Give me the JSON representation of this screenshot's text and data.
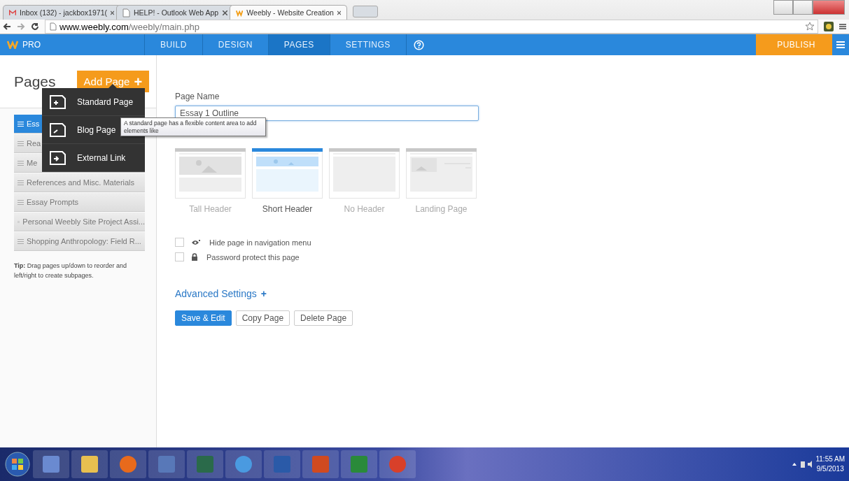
{
  "browser": {
    "tabs": [
      {
        "title": "Inbox (132) - jackbox1971(",
        "kind": "mail",
        "selected": false
      },
      {
        "title": "HELP! - Outlook Web App",
        "kind": "page",
        "selected": false
      },
      {
        "title": "Weebly - Website Creation",
        "kind": "weebly",
        "selected": true
      }
    ],
    "url_host": "www.weebly.com",
    "url_path": "/weebly/main.php"
  },
  "nav": {
    "logo_text": "PRO",
    "items": [
      {
        "label": "BUILD",
        "selected": false
      },
      {
        "label": "DESIGN",
        "selected": false
      },
      {
        "label": "PAGES",
        "selected": true
      },
      {
        "label": "SETTINGS",
        "selected": false
      }
    ],
    "publish": "PUBLISH"
  },
  "sidebar": {
    "title": "Pages",
    "add_button": "Add Page",
    "add_icon": "+",
    "pages": [
      {
        "label": "Ess",
        "selected": true
      },
      {
        "label": "Rea",
        "selected": false
      },
      {
        "label": "Me",
        "selected": false
      },
      {
        "label": "References and Misc. Materials",
        "selected": false
      },
      {
        "label": "Essay Prompts",
        "selected": false
      },
      {
        "label": "Personal Weebly Site Project Assi...",
        "selected": false
      },
      {
        "label": "Shopping Anthropology: Field R...",
        "selected": false
      }
    ],
    "tip": "**Tip:** Drag pages up/down to reorder and left/right to create subpages."
  },
  "add_menu": [
    {
      "label": "Standard Page",
      "kind": "standard"
    },
    {
      "label": "Blog Page",
      "kind": "blog"
    },
    {
      "label": "External Link",
      "kind": "link"
    }
  ],
  "tooltip": "A standard page has a flexible content area to add elements like",
  "editor": {
    "name_label": "Page Name",
    "name_value": "Essay 1 Outline",
    "layouts": [
      {
        "label": "Tall Header",
        "kind": "tall",
        "selected": false
      },
      {
        "label": "Short Header",
        "kind": "short",
        "selected": true
      },
      {
        "label": "No Header",
        "kind": "none",
        "selected": false
      },
      {
        "label": "Landing Page",
        "kind": "landing",
        "selected": false
      }
    ],
    "options": [
      {
        "label": "Hide page in navigation menu",
        "kind": "hide",
        "checked": false
      },
      {
        "label": "Password protect this page",
        "kind": "lock",
        "checked": false
      }
    ],
    "advanced": "Advanced Settings",
    "advanced_icon": "+",
    "buttons": [
      {
        "label": "Save & Edit",
        "kind": "primary"
      },
      {
        "label": "Copy Page",
        "kind": "default"
      },
      {
        "label": "Delete Page",
        "kind": "default"
      }
    ]
  },
  "taskbar": {
    "apps": [
      {
        "kind": "start"
      },
      {
        "kind": "tool"
      },
      {
        "kind": "folder"
      },
      {
        "kind": "firefox"
      },
      {
        "kind": "monitor"
      },
      {
        "kind": "hp"
      },
      {
        "kind": "itunes"
      },
      {
        "kind": "word"
      },
      {
        "kind": "powerpoint"
      },
      {
        "kind": "excel"
      },
      {
        "kind": "chrome"
      }
    ],
    "time": "11:55 AM",
    "date": "9/5/2013"
  }
}
